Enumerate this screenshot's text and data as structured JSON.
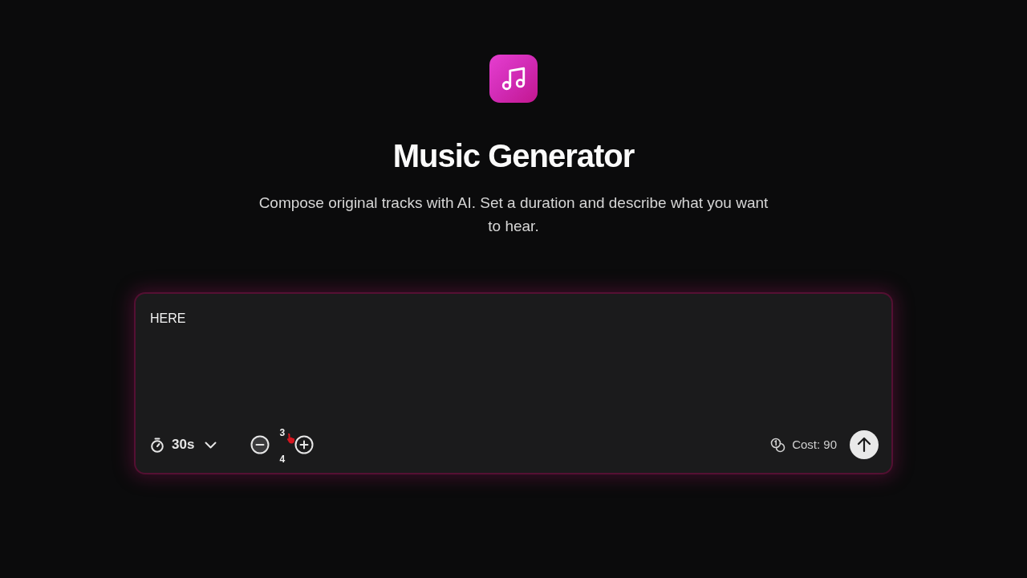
{
  "header": {
    "title": "Music Generator",
    "subtitle": "Compose original tracks with AI. Set a duration and describe what you want to hear."
  },
  "composer": {
    "prompt": {
      "value": "HERE"
    },
    "duration": {
      "value": "30s"
    },
    "count": {
      "outgoing": "3",
      "incoming": "4"
    },
    "cost": "Cost: 90"
  }
}
